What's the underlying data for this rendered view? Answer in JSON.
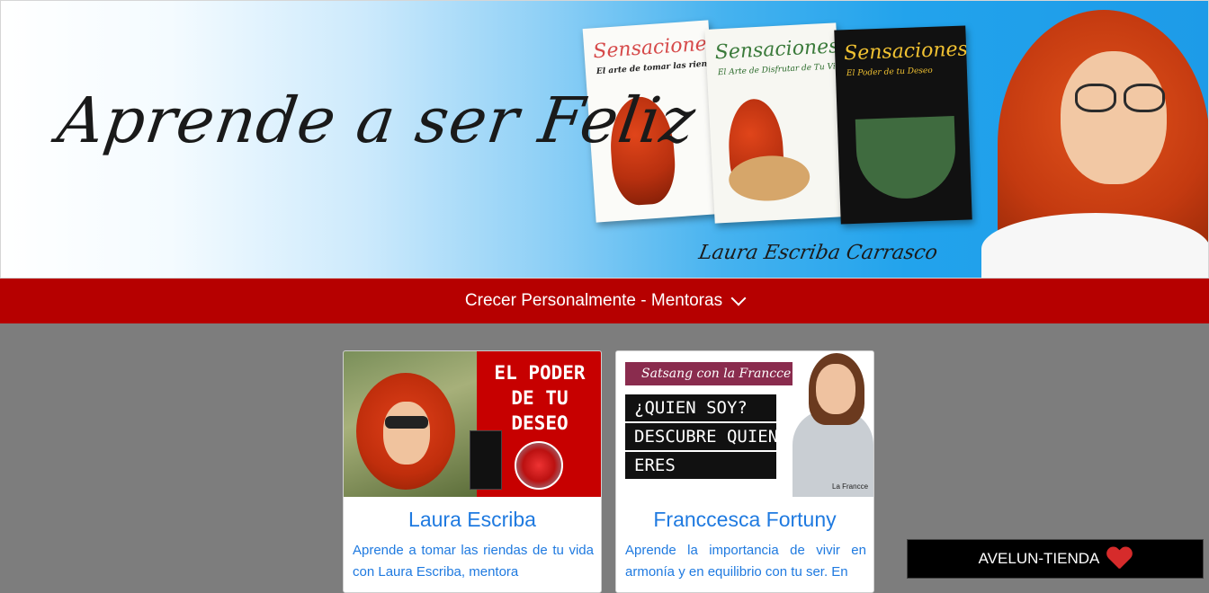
{
  "hero": {
    "title": "Aprende a ser Feliz",
    "signature": "Laura Escriba Carrasco",
    "books": [
      {
        "title": "Sensaciones",
        "subtitle": "El arte de tomar las riendas de tu vida"
      },
      {
        "title": "Sensaciones",
        "subtitle": "El Arte de Disfrutar de Tu Vida"
      },
      {
        "title": "Sensaciones",
        "subtitle": "El Poder de tu Deseo"
      }
    ]
  },
  "navbar": {
    "label": "Crecer Personalmente - Mentoras"
  },
  "cards": [
    {
      "image_text": [
        "EL PODER",
        "DE TU",
        "DESEO"
      ],
      "name": "Laura Escriba",
      "description": "Aprende a tomar las riendas de tu vida con Laura Escriba, mentora"
    },
    {
      "image_banner": "Satsang con la Francce",
      "image_lines": [
        "¿QUIEN SOY?",
        "DESCUBRE QUIEN",
        "ERES"
      ],
      "image_logo": "La Francce",
      "name": "Franccesca Fortuny",
      "description": "Aprende la importancia de vivir en armonía y en equilibrio con tu ser. En"
    }
  ],
  "shop_button": {
    "label": "AVELUN-TIENDA",
    "icon": "heart-icon",
    "icon_color": "#d62b2b"
  },
  "colors": {
    "navbar": "#b60000",
    "link": "#1f7ae0",
    "page_bg": "#7d7d7d"
  }
}
